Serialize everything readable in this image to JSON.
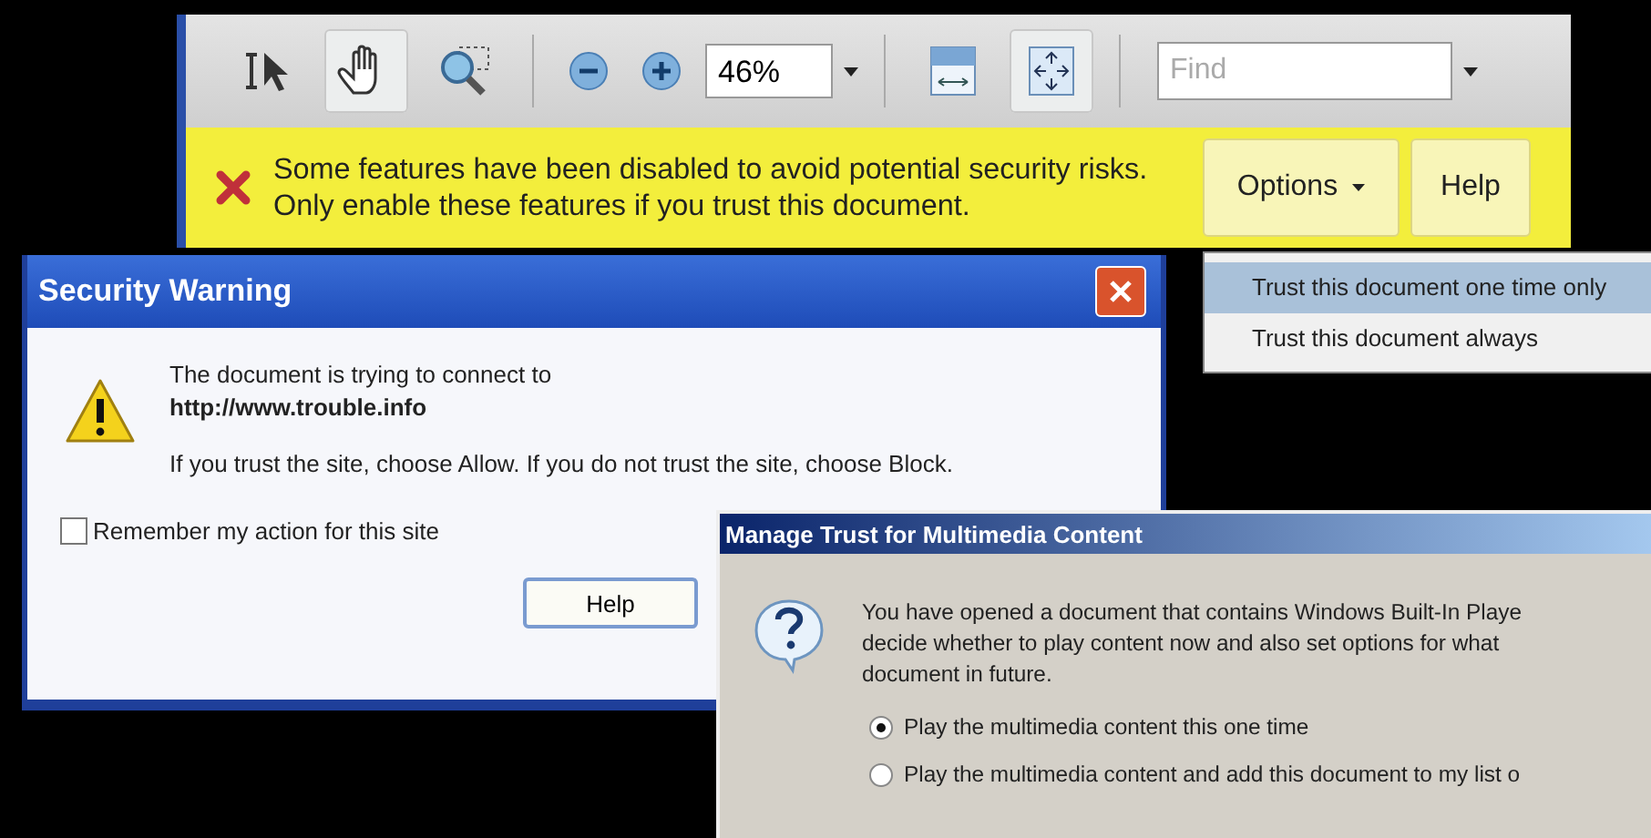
{
  "toolbar": {
    "tools": [
      {
        "kind": "select",
        "selected": false
      },
      {
        "kind": "hand",
        "selected": true
      },
      {
        "kind": "marquee_zoom",
        "selected": false
      },
      {
        "kind": "zoom_out",
        "selected": false
      },
      {
        "kind": "zoom_in",
        "selected": false
      },
      {
        "kind": "zoom_field",
        "value": "46%"
      },
      {
        "kind": "fit_width",
        "selected": false
      },
      {
        "kind": "fit_page",
        "selected": true
      },
      {
        "kind": "find_field",
        "placeholder": "Find"
      }
    ]
  },
  "security_bar": {
    "message": "Some features have been disabled to avoid potential security risks. Only enable these features if you trust this document.",
    "buttons": [
      {
        "label": "Options",
        "kind": "menu"
      },
      {
        "label": "Help",
        "kind": "plain"
      }
    ]
  },
  "options_menu": {
    "items": [
      {
        "label": "Trust this document one time only",
        "selected": true
      },
      {
        "label": "Trust this document always",
        "selected": false
      }
    ]
  },
  "security_warning": {
    "title": "Security Warning",
    "message": "The document is trying to connect to",
    "url": "http://www.trouble.info",
    "instruction": "If you trust the site, choose Allow. If you do not trust the site, choose Block.",
    "remember": {
      "label": "Remember my action for this site",
      "checked": false
    },
    "buttons": [
      "Help"
    ]
  },
  "manage_trust": {
    "title": "Manage Trust for Multimedia Content",
    "message": [
      "You have opened a document that contains Windows Built-In Playe",
      "decide whether to play content now and also set options for what",
      "document in future."
    ],
    "options": [
      {
        "label": "Play the multimedia content this one time",
        "selected": true
      },
      {
        "label": "Play the multimedia content and add this document to my list o",
        "selected": false
      }
    ]
  }
}
